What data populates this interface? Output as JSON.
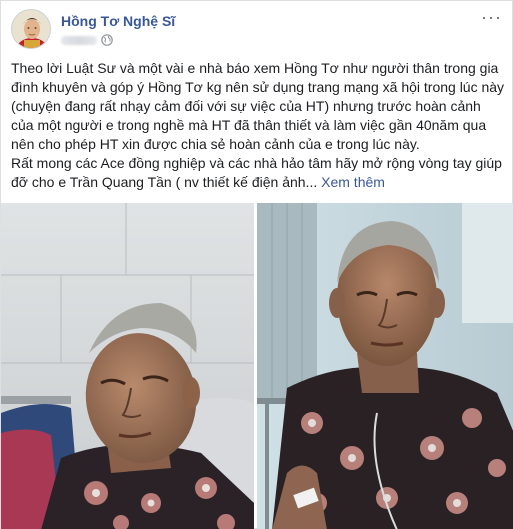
{
  "post": {
    "author": "Hồng Tơ Nghệ Sĩ",
    "more_menu": "···",
    "paragraphs": [
      "Theo lời Luật Sư và một vài e nhà báo xem Hồng Tơ như người thân trong gia đình khuyên và góp ý Hồng Tơ kg nên sử dụng trang mạng xã hội trong lúc này (chuyện đang rất nhạy cảm đối với sự việc của HT) nhưng trước hoàn cảnh của một người e trong nghề mà HT đã thân thiết và làm việc gần 40năm qua nên cho phép HT xin được chia sẻ hoàn cảnh của e trong lúc này.",
      "Rất mong các Ace đồng nghiệp và các nhà hảo tâm hãy mở rộng vòng tay giúp đỡ cho e Trần Quang Tần ( nv thiết kế điện ảnh..."
    ],
    "see_more": "Xem thêm",
    "icons": {
      "avatar": "profile-photo",
      "privacy": "globe-icon",
      "menu": "more-options-icon"
    }
  },
  "photos": [
    {
      "label": "photo-left"
    },
    {
      "label": "photo-right"
    }
  ],
  "colors": {
    "link": "#385898",
    "text": "#1c1e21",
    "meta": "#606770"
  }
}
